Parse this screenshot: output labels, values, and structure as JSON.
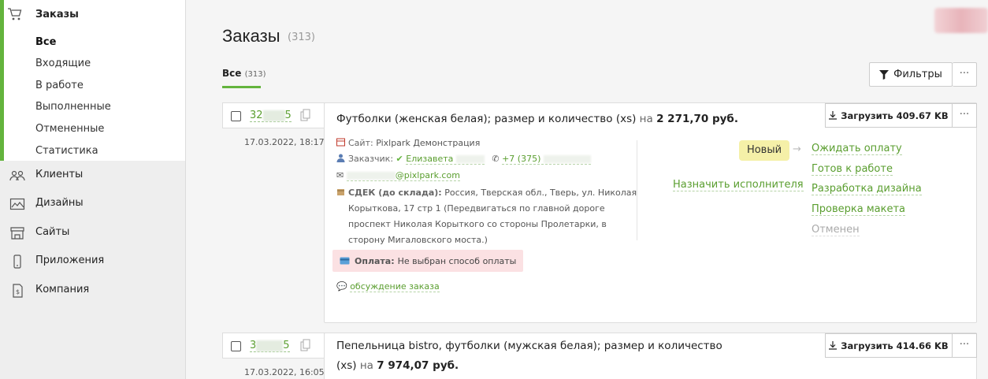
{
  "sidebar": {
    "orders_label": "Заказы",
    "sub_items": [
      {
        "label": "Все"
      },
      {
        "label": "Входящие"
      },
      {
        "label": "В работе"
      },
      {
        "label": "Выполненные"
      },
      {
        "label": "Отмененные"
      },
      {
        "label": "Статистика"
      }
    ],
    "items": [
      {
        "label": "Клиенты",
        "icon": "users-icon"
      },
      {
        "label": "Дизайны",
        "icon": "image-icon"
      },
      {
        "label": "Сайты",
        "icon": "store-icon"
      },
      {
        "label": "Приложения",
        "icon": "phone-icon"
      },
      {
        "label": "Компания",
        "icon": "document-icon"
      }
    ]
  },
  "header": {
    "title": "Заказы",
    "count": "(313)",
    "tab_label": "Все",
    "tab_count": "(313)",
    "filters_label": "Фильтры",
    "more_label": "···"
  },
  "orders": [
    {
      "id_start": "32",
      "id_end": "5",
      "date": "17.03.2022, 18:17",
      "title": "Футболки (женская белая); размер и количество (xs)",
      "na": "на",
      "price": "2 271,70 руб.",
      "download_label": "Загрузить 409.67 KB",
      "site_key": "Сайт:",
      "site_value": "Pixlpark Демонстрация",
      "customer_key": "Заказчик:",
      "customer_name": "Елизавета",
      "phone": "+7 (375)",
      "email_suffix": "@pixlpark.com",
      "delivery_key": "СДЕК (до склада):",
      "delivery_line1": "Россия, Тверская обл., Тверь, ул. Николая",
      "delivery_rest": "Корыткова, 17 стр 1 (Передвигаться по главной дороге проспект Николая Корыткого со стороны Пролетарки, в сторону Мигаловского моста.)",
      "payment_key": "Оплата:",
      "payment_value": "Не выбран способ оплаты",
      "discussion": "обсуждение заказа",
      "assign": "Назначить исполнителя",
      "status": "Новый",
      "arrow": "→",
      "next_statuses": [
        "Ожидать оплату",
        "Готов к работе",
        "Разработка дизайна",
        "Проверка макета",
        "Отменен"
      ]
    },
    {
      "id_start": "3",
      "id_end": "5",
      "date": "17.03.2022, 16:05",
      "title_line1": "Пепельница bistro, футболки (мужская белая); размер и количество",
      "title_line2": "(xs)",
      "na": "на",
      "price": "7 974,07 руб.",
      "download_label": "Загрузить 414.66 KB"
    }
  ],
  "colors": {
    "accent": "#63b43d",
    "link": "#5a9e2f",
    "status_new_bg": "#f5f0a8",
    "payment_bg": "#fbe1e3"
  }
}
